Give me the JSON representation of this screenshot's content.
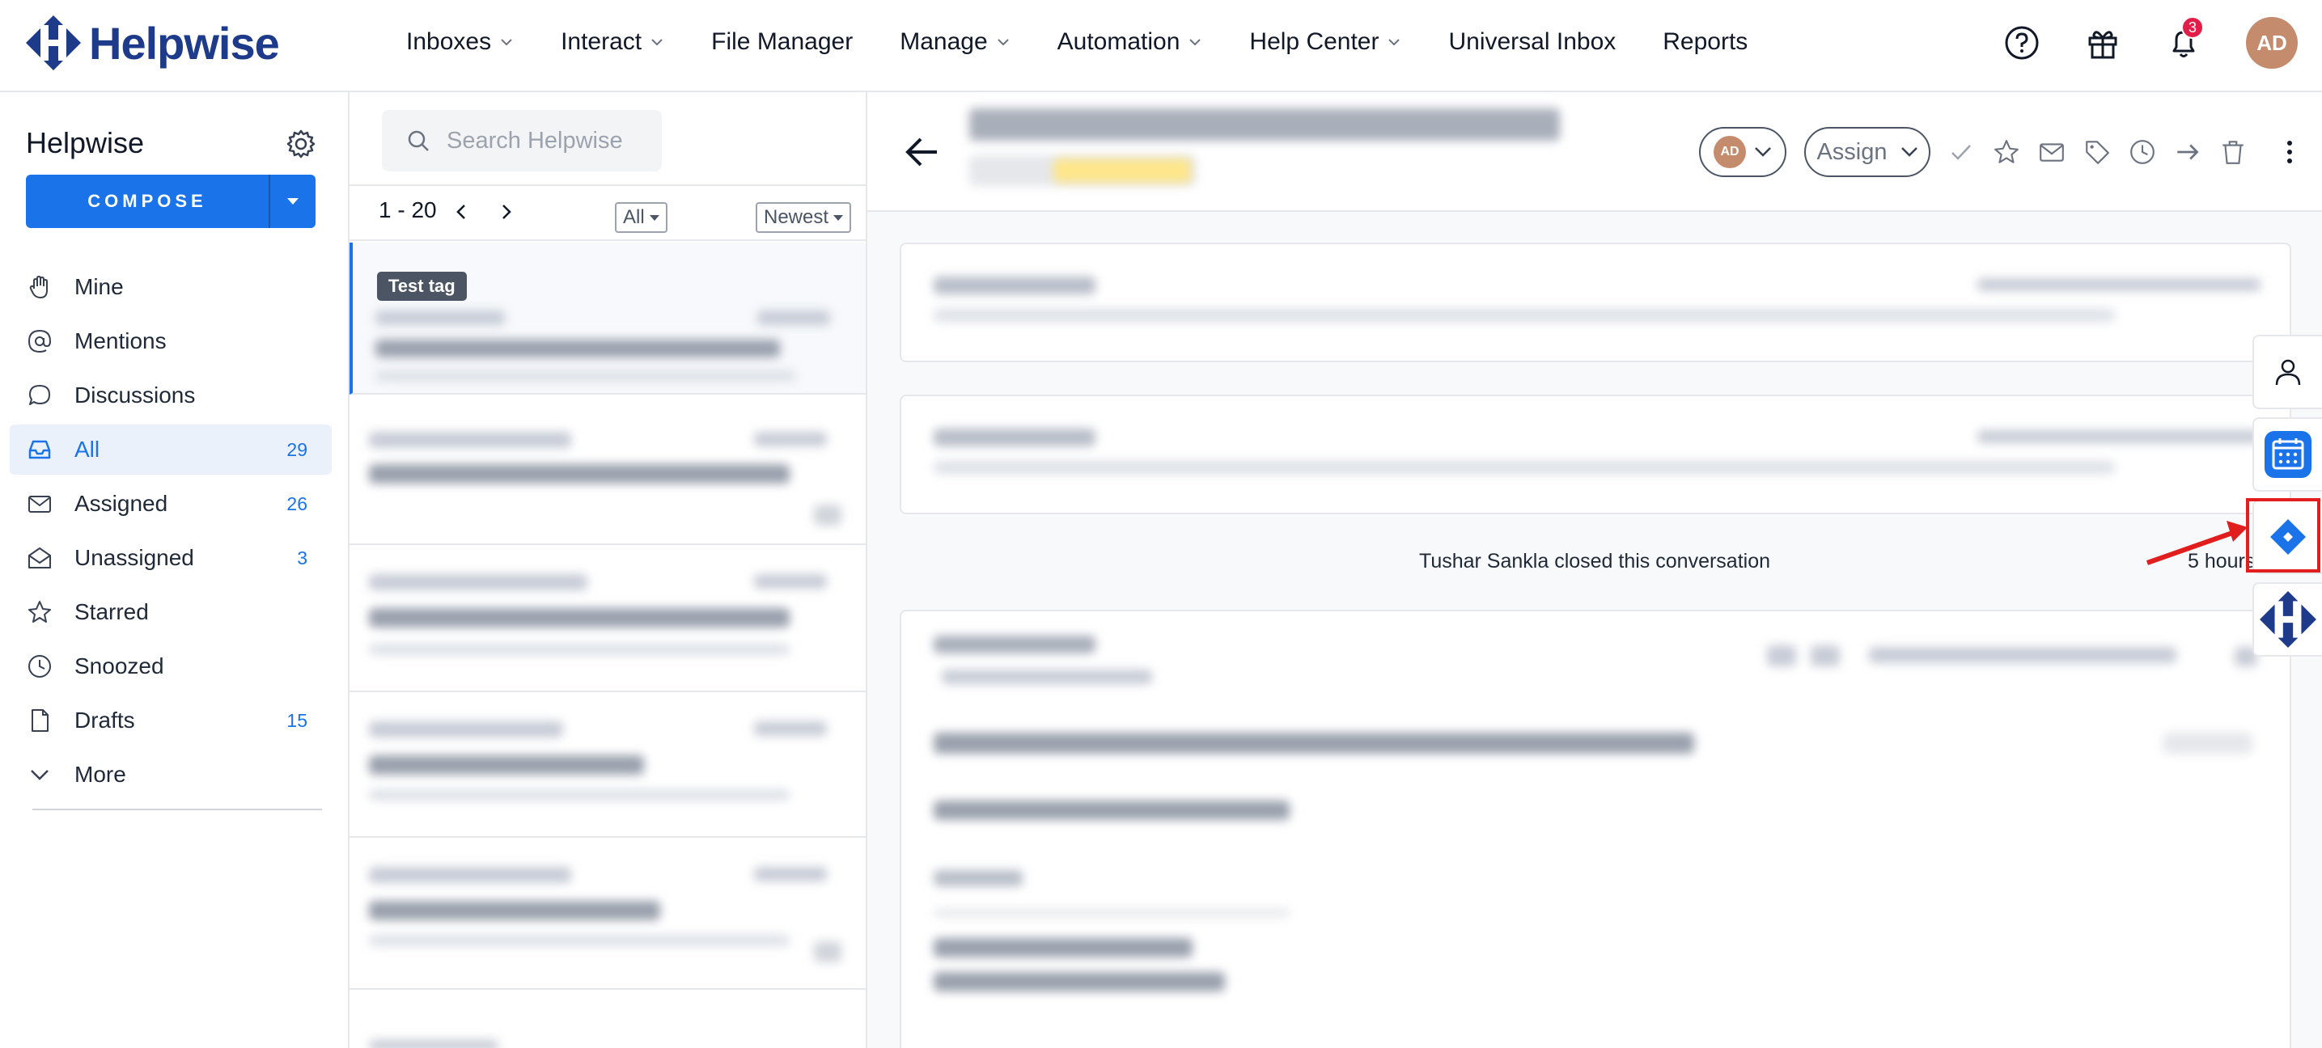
{
  "app": {
    "brand": "Helpwise",
    "accent": "#1a73e8",
    "brand_color": "#1e3a8a"
  },
  "nav": {
    "items": [
      {
        "label": "Inboxes",
        "has_dropdown": true
      },
      {
        "label": "Interact",
        "has_dropdown": true
      },
      {
        "label": "File Manager",
        "has_dropdown": false
      },
      {
        "label": "Manage",
        "has_dropdown": true
      },
      {
        "label": "Automation",
        "has_dropdown": true
      },
      {
        "label": "Help Center",
        "has_dropdown": true
      },
      {
        "label": "Universal Inbox",
        "has_dropdown": false
      },
      {
        "label": "Reports",
        "has_dropdown": false
      }
    ],
    "notification_count": "3",
    "avatar_initials": "AD",
    "icons": [
      "help-circle-icon",
      "gift-icon",
      "bell-icon"
    ]
  },
  "sidebar": {
    "title": "Helpwise",
    "compose_label": "COMPOSE",
    "items": [
      {
        "label": "Mine",
        "icon": "hand-icon",
        "count": ""
      },
      {
        "label": "Mentions",
        "icon": "at-icon",
        "count": ""
      },
      {
        "label": "Discussions",
        "icon": "chat-bubble-icon",
        "count": ""
      },
      {
        "label": "All",
        "icon": "inbox-icon",
        "count": "29"
      },
      {
        "label": "Assigned",
        "icon": "mail-icon",
        "count": "26"
      },
      {
        "label": "Unassigned",
        "icon": "open-mail-icon",
        "count": "3"
      },
      {
        "label": "Starred",
        "icon": "star-icon",
        "count": ""
      },
      {
        "label": "Snoozed",
        "icon": "clock-icon",
        "count": ""
      },
      {
        "label": "Drafts",
        "icon": "draft-icon",
        "count": "15"
      },
      {
        "label": "More",
        "icon": "chevron-down-icon",
        "count": ""
      }
    ]
  },
  "conversation_list": {
    "search_placeholder": "Search Helpwise",
    "range": "1 - 20",
    "filter": "All",
    "sort": "Newest",
    "first_tag": "Test tag"
  },
  "conversation": {
    "assign_label": "Assign",
    "assignee_initials": "AD",
    "closed_note": "Tushar Sankla closed this conversation",
    "time_note": "5 hours"
  }
}
